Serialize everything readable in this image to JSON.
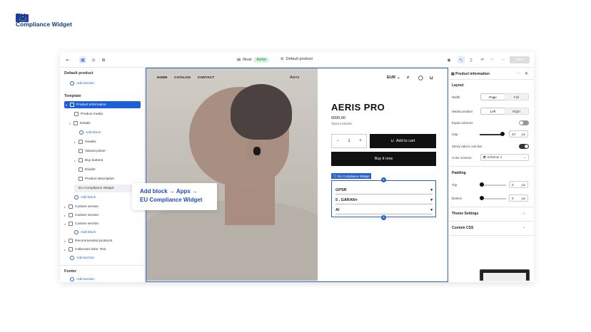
{
  "brand": {
    "eu": "EU",
    "name": "Compliance Widget",
    "flag_color": "#1f3fa6"
  },
  "toolbar": {
    "theme_name": "Rival",
    "theme_status": "Active",
    "page_name": "Default product",
    "save_label": "Save"
  },
  "left": {
    "page_title": "Default product",
    "add_section_top": "Add section",
    "template_heading": "Template",
    "items": {
      "product_info": "Product information",
      "product_media": "Product media",
      "details": "Details",
      "add_block_1": "Add block",
      "header": "Header",
      "variant_picker": "Variant picker",
      "buy_buttons": "Buy buttons",
      "divider": "Divider",
      "product_description": "Product description",
      "eu_widget": "EU Compliance Widget",
      "add_block_2": "Add block",
      "custom_section_1": "Custom section",
      "custom_section_2": "Custom section",
      "custom_section_3": "Custom section",
      "add_block_3": "Add block",
      "recommended": "Recommended products",
      "collection_links": "Collection links: Text",
      "add_section_mid": "Add section"
    },
    "footer_heading": "Footer",
    "add_section_bottom": "Add section"
  },
  "callout": {
    "line1": "Add block → Apps →",
    "line2": "EU Compliance Widget"
  },
  "store": {
    "nav": [
      "HOME",
      "CATALOG",
      "CONTACT"
    ],
    "logo": "Aeris",
    "currency": "EUR",
    "product_title": "AERIS PRO",
    "price": "€600,00",
    "tax_note": "Taxes included.",
    "quantity": "1",
    "add_to_cart": "Add to cart",
    "buy_now": "Buy it now",
    "widget_label": "EU Compliance Widget",
    "widget_rows": [
      "GPSR",
      "5  . GARAN+",
      "AI"
    ]
  },
  "right": {
    "panel_title": "Product information",
    "layout_heading": "Layout",
    "width_label": "Width",
    "width_options": [
      "Page",
      "Full"
    ],
    "media_position_label": "Media position",
    "media_options": [
      "Left",
      "Right"
    ],
    "equal_columns_label": "Equal columns",
    "equal_columns_on": false,
    "gap_label": "Gap",
    "gap_value": "44",
    "gap_unit": "px",
    "gap_fraction": 0.9,
    "sticky_label": "Sticky add to cart bar",
    "sticky_on": true,
    "color_scheme_label": "Color scheme",
    "color_scheme_value": "Scheme 1",
    "padding_heading": "Padding",
    "top_label": "Top",
    "top_value": "0",
    "bottom_label": "Bottom",
    "bottom_value": "0",
    "unit": "px",
    "theme_settings": "Theme Settings",
    "custom_css": "Custom CSS"
  }
}
